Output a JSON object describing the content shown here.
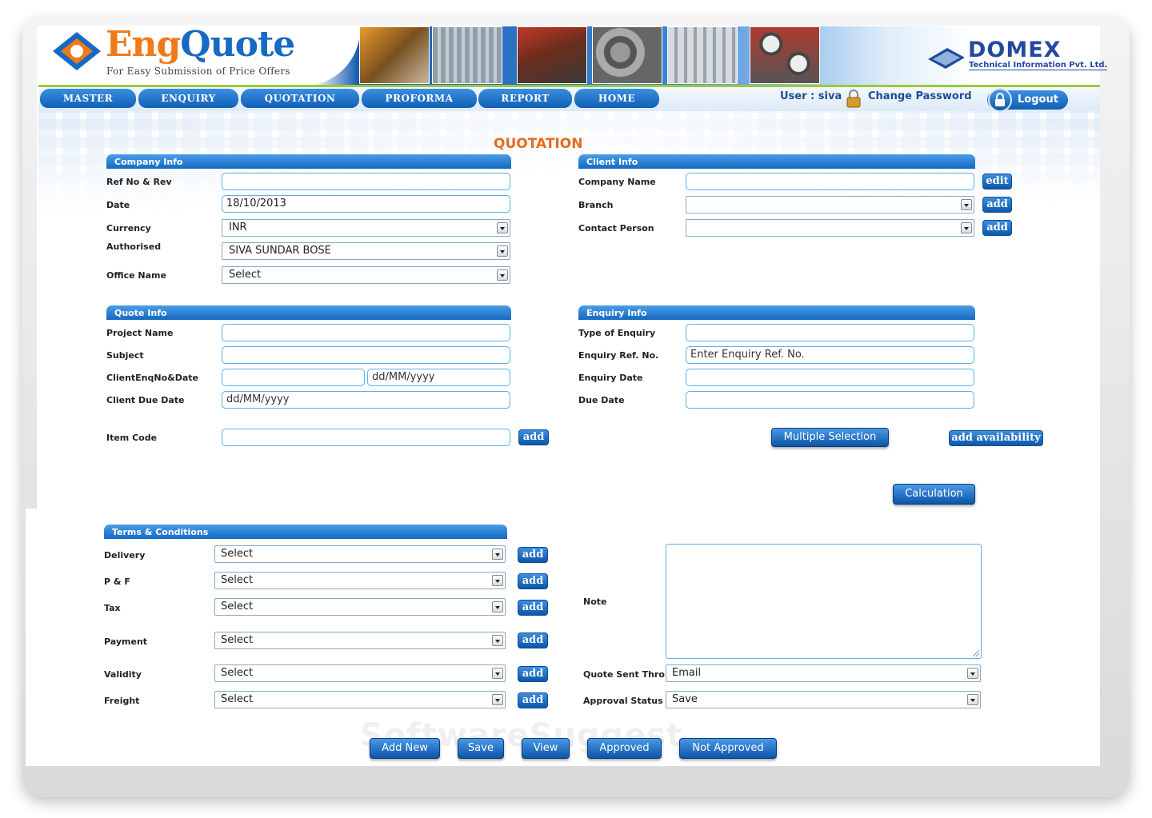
{
  "brand": {
    "logo_eng": "Eng",
    "logo_quote": "Quote",
    "tagline": "For Easy Submission of Price Offers",
    "vendor_name": "DOMEX",
    "vendor_sub": "Technical Information Pvt. Ltd."
  },
  "nav": {
    "items": [
      "MASTER",
      "ENQUIRY",
      "QUOTATION",
      "PROFORMA",
      "REPORT",
      "HOME"
    ]
  },
  "user": {
    "label": "User : siva",
    "change_password": "Change Password",
    "logout": "Logout"
  },
  "page": {
    "title": "QUOTATION"
  },
  "company": {
    "header": "Company Info",
    "ref_label": "Ref No & Rev",
    "ref_value": "",
    "date_label": "Date",
    "date_value": "18/10/2013",
    "currency_label": "Currency",
    "currency_value": "INR",
    "authorised_label": "Authorised",
    "authorised_value": "SIVA SUNDAR BOSE",
    "office_label": "Office Name",
    "office_value": "Select"
  },
  "client": {
    "header": "Client Info",
    "company_label": "Company Name",
    "company_value": "",
    "branch_label": "Branch",
    "branch_value": "",
    "contact_label": "Contact Person",
    "contact_value": "",
    "edit_btn": "edit",
    "add_btn": "add"
  },
  "quote": {
    "header": "Quote Info",
    "project_label": "Project Name",
    "subject_label": "Subject",
    "clientenq_label": "ClientEnqNo&Date",
    "clientenq_date_placeholder": "dd/MM/yyyy",
    "due_label": "Client Due Date",
    "due_placeholder": "dd/MM/yyyy",
    "item_label": "Item Code",
    "add_btn": "add"
  },
  "enquiry": {
    "header": "Enquiry Info",
    "type_label": "Type of Enquiry",
    "ref_label": "Enquiry Ref. No.",
    "ref_placeholder": "Enter Enquiry Ref. No.",
    "date_label": "Enquiry Date",
    "due_label": "Due Date"
  },
  "actions": {
    "multiple": "Multiple Selection",
    "availability": "add availability",
    "calculation": "Calculation"
  },
  "terms": {
    "header": "Terms & Conditions",
    "rows": [
      {
        "label": "Delivery",
        "value": "Select"
      },
      {
        "label": "P & F",
        "value": "Select"
      },
      {
        "label": "Tax",
        "value": "Select"
      },
      {
        "label": "Payment",
        "value": "Select"
      },
      {
        "label": "Validity",
        "value": "Select"
      },
      {
        "label": "Freight",
        "value": "Select"
      }
    ],
    "add_btn": "add",
    "note_label": "Note",
    "sent_label": "Quote Sent Thro",
    "sent_value": "Email",
    "approval_label": "Approval Status",
    "approval_value": "Save"
  },
  "footer": {
    "buttons": [
      "Add New",
      "Save",
      "View",
      "Approved",
      "Not Approved"
    ]
  },
  "watermark": "SoftwareSuggest"
}
